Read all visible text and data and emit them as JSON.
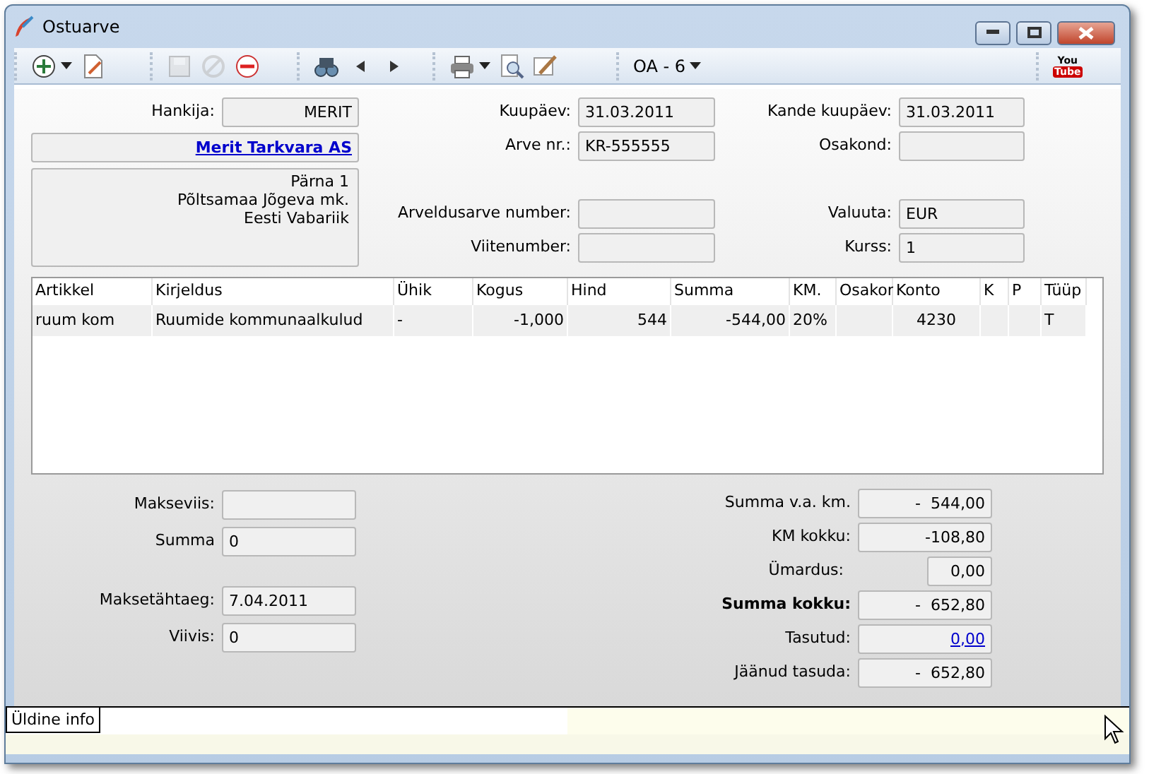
{
  "window": {
    "title": "Ostuarve"
  },
  "toolbar": {
    "groups": [
      [
        {
          "kind": "add",
          "menu": true,
          "disabled": false
        },
        {
          "kind": "edit",
          "menu": false,
          "disabled": false
        }
      ],
      [
        {
          "kind": "save",
          "menu": false,
          "disabled": true
        },
        {
          "kind": "cancel",
          "menu": false,
          "disabled": true
        },
        {
          "kind": "delete",
          "menu": false,
          "disabled": false
        }
      ],
      [
        {
          "kind": "find",
          "menu": false,
          "disabled": false
        },
        {
          "kind": "previous",
          "menu": false,
          "disabled": false
        },
        {
          "kind": "next",
          "menu": false,
          "disabled": false
        }
      ],
      [
        {
          "kind": "print",
          "menu": true,
          "disabled": false
        },
        {
          "kind": "preview",
          "menu": false,
          "disabled": false
        },
        {
          "kind": "sign",
          "menu": false,
          "disabled": false
        }
      ],
      [
        {
          "kind": "selector",
          "label": "OA - 6",
          "menu": true,
          "disabled": false
        }
      ],
      [
        {
          "kind": "video",
          "label": "You",
          "label2": "Tube",
          "menu": false,
          "disabled": false
        }
      ]
    ]
  },
  "supplier": {
    "code_label": "Hankija:",
    "code": "MERIT",
    "name": "Merit Tarkvara AS",
    "address": [
      "Pärna 1",
      "Põltsamaa Jõgeva mk.",
      "Eesti Vabariik"
    ]
  },
  "invoice_fields": [
    {
      "label": "Kuupäev:",
      "value": "31.03.2011"
    },
    {
      "label": "Arve nr.:",
      "value": "KR-555555"
    },
    {
      "label": "Arveldusarve number:"
    },
    {
      "label": "Viitenumber:"
    }
  ],
  "entry_fields": [
    {
      "label": "Kande kuupäev:",
      "value": "31.03.2011"
    },
    {
      "label": "Osakond:"
    },
    {
      "label": "Valuuta:",
      "value": "EUR"
    },
    {
      "label": "Kurss:",
      "value": "1"
    }
  ],
  "lines": {
    "columns": [
      "Artikkel",
      "Kirjeldus",
      "Ühik",
      "Kogus",
      "Hind",
      "Summa",
      "KM.",
      "Osakon",
      "Konto",
      "K",
      "P",
      "Tüüp"
    ],
    "rows": [
      [
        "ruum kom",
        "Ruumide kommunaalkulud",
        "-",
        "-1,000",
        "544",
        "-544,00",
        "20%",
        "",
        "4230",
        "",
        "",
        "T"
      ]
    ]
  },
  "payment": [
    {
      "label": "Makseviis:"
    },
    {
      "label": "Summa",
      "value": "0"
    },
    {
      "label": "Maksetähtaeg:",
      "value": "7.04.2011"
    },
    {
      "label": "Viivis:",
      "value": "0"
    }
  ],
  "totals": [
    {
      "label": "Summa v.a. km.",
      "value": "-  544,00",
      "kind": "plain"
    },
    {
      "label": "KM kokku:",
      "value": "-108,80",
      "kind": "plain"
    },
    {
      "label": "Ümardus:",
      "value": "0,00",
      "kind": "short"
    },
    {
      "label": "Summa kokku:",
      "value": "-  652,80",
      "kind": "bold"
    },
    {
      "label": "Tasutud:",
      "value": "0,00",
      "kind": "link"
    },
    {
      "label": "Jäänud tasuda:",
      "value": "-  652,80",
      "kind": "plain"
    }
  ],
  "tabs": [
    {
      "label": "Üldine info",
      "selected": true
    }
  ]
}
